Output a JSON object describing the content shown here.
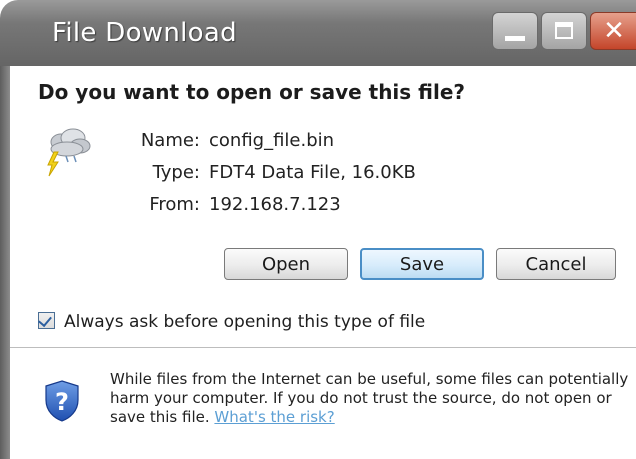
{
  "window": {
    "title": "File Download",
    "controls": {
      "minimize": "minimize-icon",
      "maximize": "maximize-icon",
      "close": "close-icon"
    }
  },
  "question": "Do you want to open or save this file?",
  "file": {
    "icon": "weather-storm-icon",
    "name_label": "Name:",
    "name": "config_file.bin",
    "type_label": "Type:",
    "type": "FDT4 Data File, 16.0KB",
    "from_label": "From:",
    "from": "192.168.7.123"
  },
  "buttons": {
    "open": "Open",
    "save": "Save",
    "cancel": "Cancel"
  },
  "checkbox": {
    "label": "Always ask before opening this type of file",
    "checked": true
  },
  "warning": {
    "icon": "shield-question-icon",
    "text": "While files from the Internet can be useful, some files can potentially harm your computer. If you do not trust the source, do not open or save this file. ",
    "link": "What's the risk?"
  },
  "colors": {
    "title_bar": "#777777",
    "close_button": "#c4452a",
    "default_button_border": "#4a8ec6",
    "link": "#5c9fd4"
  }
}
